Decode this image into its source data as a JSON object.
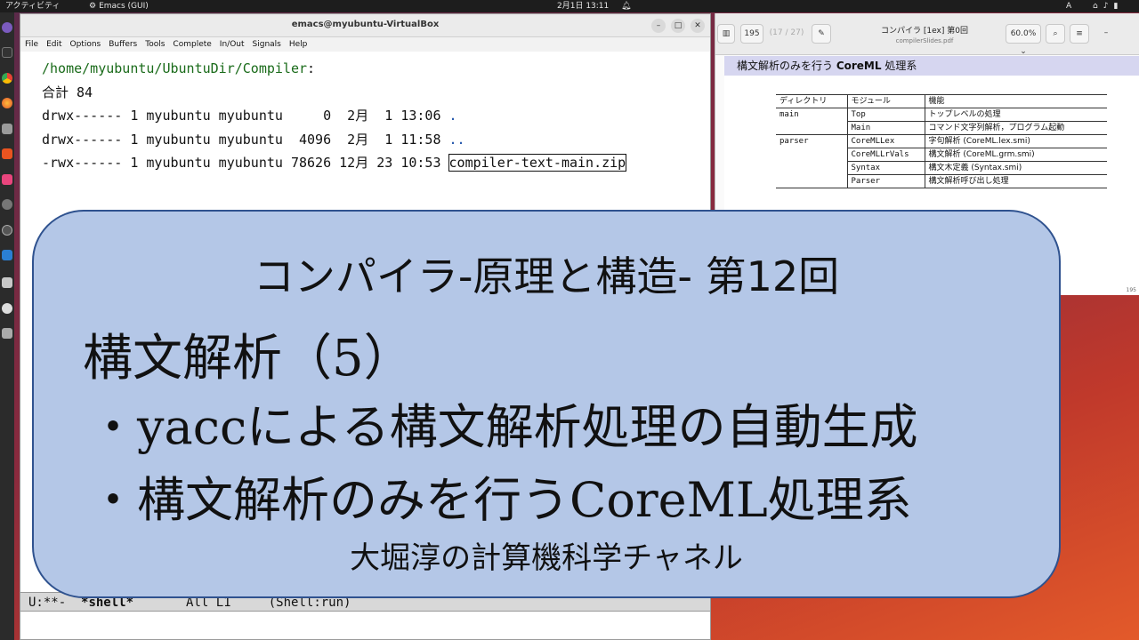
{
  "topbar": {
    "activities": "アクティビティ",
    "app_name": "Emacs (GUI)",
    "clock": "2月1日  13:11",
    "input_method": "A"
  },
  "emacs": {
    "window_title": "emacs@myubuntu-VirtualBox",
    "menu": [
      "File",
      "Edit",
      "Options",
      "Buffers",
      "Tools",
      "Complete",
      "In/Out",
      "Signals",
      "Help"
    ],
    "buffer": {
      "dir_path": "/home/myubuntu/UbuntuDir/Compiler",
      "dir_colon": ":",
      "total": "合計 84",
      "entries": [
        {
          "meta": "drwx------ 1 myubuntu myubuntu     0  2月  1 13:06 ",
          "name": "."
        },
        {
          "meta": "drwx------ 1 myubuntu myubuntu  4096  2月  1 11:58 ",
          "name": ".."
        },
        {
          "meta": "-rwx------ 1 myubuntu myubuntu 78626 12月 23 10:53 ",
          "name": "compiler-text-main.zip"
        }
      ]
    },
    "modeline": {
      "status": "U:**-  ",
      "buffer_name": "*shell*",
      "position": "       All L1     ",
      "mode": "(Shell:run)"
    }
  },
  "pdf": {
    "page_current": "195",
    "page_total": "(17 / 27)",
    "title": "コンパイラ [1ex] 第0回",
    "filename": "compilerSlides.pdf",
    "zoom": "60.0%",
    "slide_heading_pre": "構文解析のみを行う ",
    "slide_heading_bold": "CoreML",
    "slide_heading_post": " 処理系",
    "table": {
      "headers": [
        "ディレクトリ",
        "モジュール",
        "機能"
      ],
      "rows": [
        [
          "main",
          "Top",
          "トップレベルの処理"
        ],
        [
          "",
          "Main",
          "コマンド文字列解析，プログラム起動"
        ],
        [
          "parser",
          "CoreMLLex",
          "字句解析 (CoreML.lex.smi)"
        ],
        [
          "",
          "CoreMLLrVals",
          "構文解析 (CoreML.grm.smi)"
        ],
        [
          "",
          "Syntax",
          "構文木定義 (Syntax.smi)"
        ],
        [
          "",
          "Parser",
          "構文解析呼び出し処理"
        ]
      ]
    },
    "page_number": "195"
  },
  "overlay": {
    "series_title": "コンパイラ-原理と構造- 第12回",
    "chapter": "構文解析（5）",
    "bullet1": "・yaccによる構文解析処理の自動生成",
    "bullet2": "・構文解析のみを行うCoreML処理系",
    "channel": "大堀淳の計算機科学チャネル"
  },
  "icons": {
    "dock": [
      "emacs-icon",
      "terminal-icon",
      "chrome-icon",
      "firefox-icon",
      "files-icon",
      "software-icon",
      "app-icon",
      "settings-icon",
      "ubuntu-icon",
      "vscode-icon",
      "document-icon",
      "disc-icon",
      "drive-icon"
    ]
  }
}
